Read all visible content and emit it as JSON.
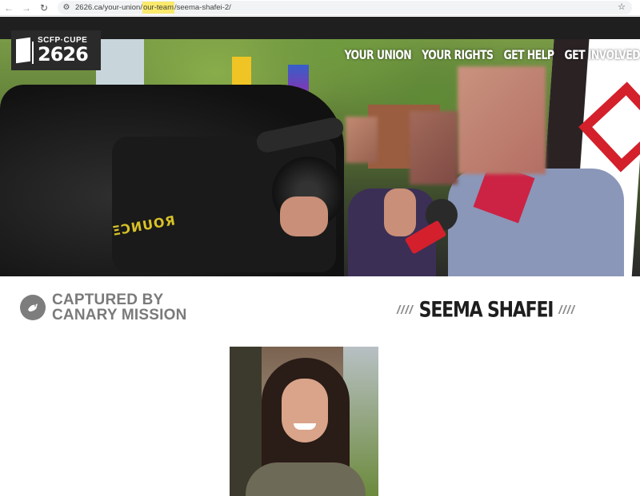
{
  "browser": {
    "back_icon": "arrow-left-icon",
    "forward_icon": "arrow-right-icon",
    "reload_icon": "reload-icon",
    "url_parts": {
      "pre": "2626.ca/your-union/",
      "highlight": "our-team",
      "post": "/seema-shafei-2/"
    },
    "bookmark_icon": "star-icon",
    "colors": {
      "highlight": "#fbea6b"
    }
  },
  "site": {
    "logo_top": "SCFP·CUPE",
    "logo_number": "2626",
    "nav": [
      "YOUR UNION",
      "YOUR RIGHTS",
      "GET HELP",
      "GET INVOLVED"
    ]
  },
  "hero": {
    "strap_text": "ΞƆИUOЯ"
  },
  "watermark": {
    "line1": "CAPTURED BY",
    "line2": "CANARY MISSION",
    "icon": "canary-bird-icon"
  },
  "profile": {
    "slashes_left": "////",
    "name": "SEEMA SHAFEI",
    "slashes_right": "////"
  }
}
